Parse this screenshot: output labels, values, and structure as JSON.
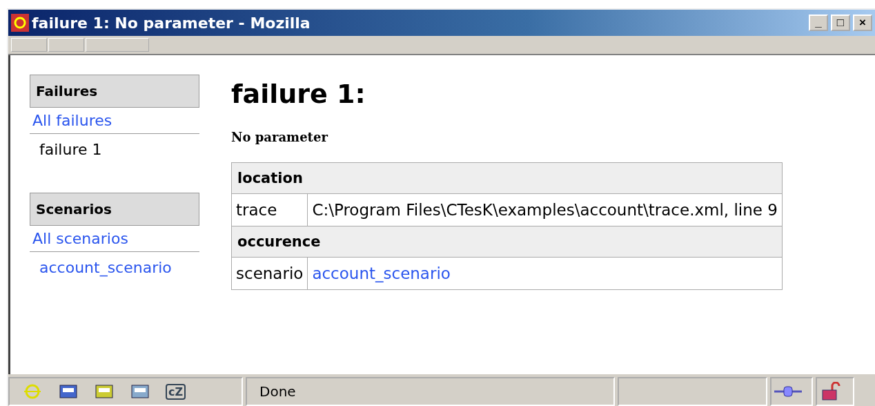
{
  "window": {
    "title": "failure 1: No parameter - Mozilla",
    "controls": [
      "_",
      "□",
      "×"
    ]
  },
  "sidebar": [
    {
      "heading": "Failures",
      "items": [
        {
          "label": "All failures",
          "kind": "link"
        },
        {
          "label": "failure 1",
          "kind": "current"
        }
      ]
    },
    {
      "heading": "Scenarios",
      "items": [
        {
          "label": "All scenarios",
          "kind": "link"
        },
        {
          "label": "account_scenario",
          "kind": "sublink"
        }
      ]
    }
  ],
  "page": {
    "title": "failure 1:",
    "subtitle": "No parameter"
  },
  "table": {
    "rows": [
      {
        "kind": "section",
        "label": "location"
      },
      {
        "kind": "field",
        "key": "trace",
        "value": "C:\\Program Files\\CTesK\\examples\\account\\trace.xml, line 9",
        "link": false
      },
      {
        "kind": "section",
        "label": "occurence"
      },
      {
        "kind": "field",
        "key": "scenario",
        "value": "account_scenario",
        "link": true
      }
    ]
  },
  "status_bar": {
    "chat_label": "cZ",
    "status": "Done"
  }
}
